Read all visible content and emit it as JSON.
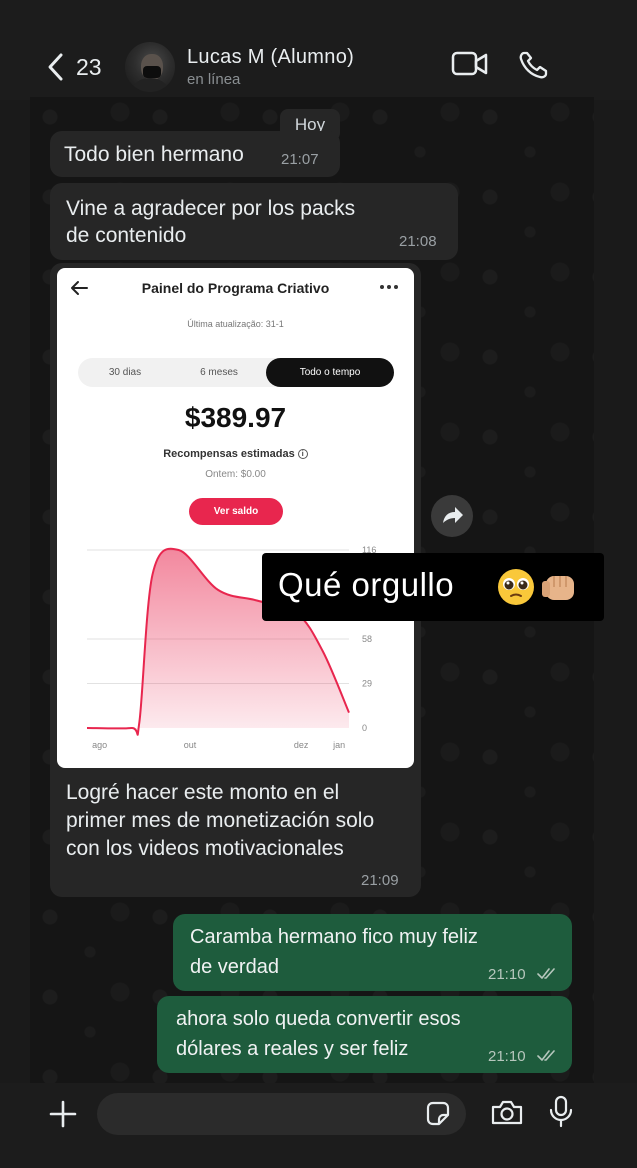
{
  "header": {
    "back_count": "23",
    "contact_name": "Lucas M (Alumno)",
    "status": "en línea"
  },
  "chat": {
    "date_chip": "Hoy",
    "messages": [
      {
        "dir": "in",
        "text": "Todo bien hermano",
        "time": "21:07"
      },
      {
        "dir": "in",
        "text": "Vine a agradecer por los packs de contenido",
        "lines": [
          "Vine a agradecer por los packs",
          "de contenido"
        ],
        "time": "21:08"
      },
      {
        "dir": "in",
        "type": "image",
        "lines": [
          "Logré hacer este monto en el",
          "primer mes de monetización solo",
          "con los videos motivacionales"
        ],
        "time": "21:09"
      },
      {
        "dir": "out",
        "lines": [
          "Caramba hermano fico muy feliz",
          "de verdad"
        ],
        "time": "21:10",
        "status": "read"
      },
      {
        "dir": "out",
        "lines": [
          "ahora solo queda convertir esos",
          "dólares a reales y ser feliz"
        ],
        "time": "21:10",
        "status": "read"
      }
    ]
  },
  "screenshot": {
    "title": "Painel do Programa Criativo",
    "updated": "Última atualização: 31-1",
    "tabs": [
      "30 dias",
      "6 meses",
      "Todo o tempo"
    ],
    "active_tab": "Todo o tempo",
    "amount": "$389.97",
    "amount_label": "Recompensas estimadas",
    "yesterday": "Ontem: $0.00",
    "button": "Ver saldo",
    "chart_data": {
      "type": "area",
      "x_ticks": [
        "ago",
        "out",
        "dez",
        "jan"
      ],
      "y_ticks": [
        "0",
        "29",
        "58",
        "116"
      ],
      "ylim": [
        0,
        116
      ],
      "series_color": "#e8264e",
      "x": [
        0,
        0.17,
        0.2,
        0.25,
        0.35,
        0.5,
        0.65,
        0.8,
        0.9,
        1.0
      ],
      "values": [
        0,
        0,
        4,
        100,
        116,
        90,
        83,
        75,
        50,
        10
      ]
    }
  },
  "overlay_caption": "Qué orgullo",
  "overlay_emojis": [
    "pleading-face",
    "fist-bump"
  ],
  "colors": {
    "incoming_bubble": "#262626",
    "outgoing_bubble": "#1e5c3d",
    "background": "#151515",
    "accent": "#e8264e"
  }
}
